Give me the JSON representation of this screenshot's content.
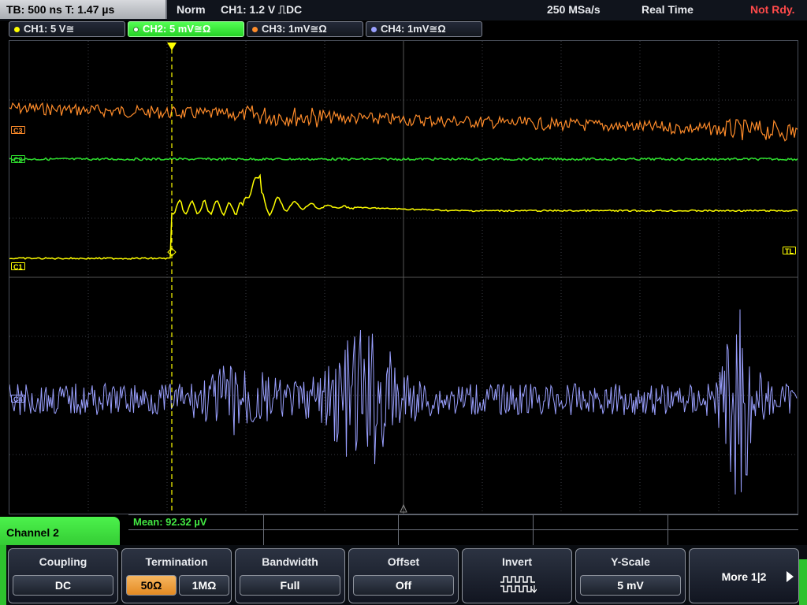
{
  "topbar": {
    "timebase": "TB: 500 ns   T: 1.47 µs",
    "mode": "Norm",
    "trigger": "CH1: 1.2 V ⎍DC",
    "samplerate": "250 MSa/s",
    "acq_mode": "Real Time",
    "status": "Not Rdy."
  },
  "channels": [
    {
      "label": "CH1: 5 V≅",
      "color": "#ffff00"
    },
    {
      "label": "CH2: 5 mV≅Ω",
      "color": "#2ee02e"
    },
    {
      "label": "CH3: 1mV≅Ω",
      "color": "#ff8c2a"
    },
    {
      "label": "CH4: 1mV≅Ω",
      "color": "#9aa0ff"
    }
  ],
  "markers": {
    "c3": "C3",
    "c2": "C2",
    "c1": "C1",
    "c4": "C4",
    "tl": "TL"
  },
  "side_menu_title": "Channel 2",
  "measurement": {
    "mean": "Mean: 92.32 µV"
  },
  "softkeys": {
    "coupling": {
      "title": "Coupling",
      "value": "DC"
    },
    "termination": {
      "title": "Termination",
      "opt1": "50Ω",
      "opt2": "1MΩ",
      "selected": "50Ω"
    },
    "bandwidth": {
      "title": "Bandwidth",
      "value": "Full"
    },
    "offset": {
      "title": "Offset",
      "value": "Off"
    },
    "invert": {
      "title": "Invert"
    },
    "yscale": {
      "title": "Y-Scale",
      "value": "5 mV"
    },
    "more": "More 1|2"
  }
}
